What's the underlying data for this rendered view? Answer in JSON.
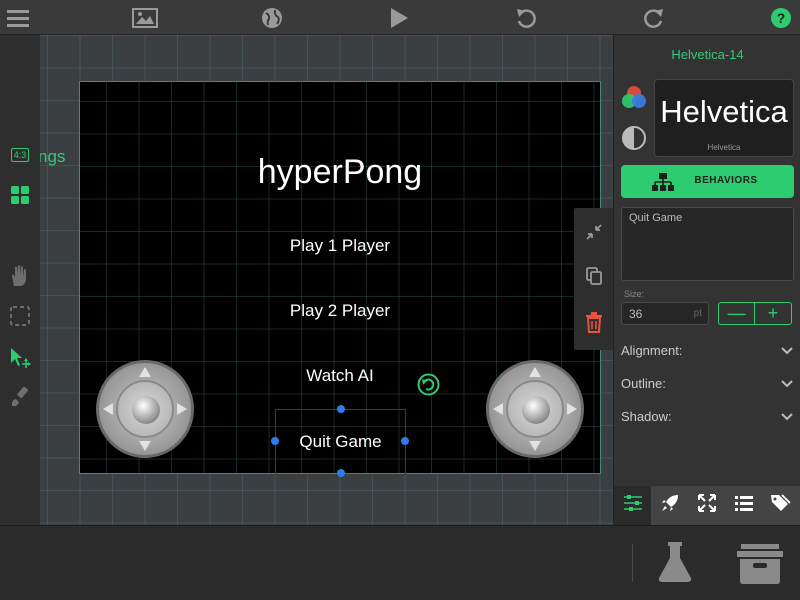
{
  "toolbar": {
    "icons": [
      "menu-icon",
      "image-icon",
      "globe-icon",
      "play-icon",
      "undo-icon",
      "redo-icon",
      "help-icon"
    ]
  },
  "left_tools": {
    "aspect_label": "4:3",
    "icons": [
      "aspect-ratio-icon",
      "grid-icon",
      "hand-icon",
      "marquee-select-icon",
      "pointer-move-icon",
      "brush-icon"
    ]
  },
  "canvas": {
    "partial_label": "ngs",
    "title": "hyperPong",
    "menu": [
      "Play 1 Player",
      "Play 2 Player",
      "Watch AI",
      "Quit Game"
    ]
  },
  "inspector": {
    "font_name": "Helvetica-14",
    "font_preview_large": "Helvetica",
    "font_preview_small": "Helvetica",
    "behaviors_label": "BEHAVIORS",
    "text_value": "Quit Game",
    "size_label": "Size:",
    "size_value": "36",
    "size_unit": "pt",
    "minus_label": "—",
    "plus_label": "+",
    "properties": [
      "Alignment:",
      "Outline:",
      "Shadow:"
    ]
  },
  "colors": {
    "accent": "#2ecc71",
    "selection": "#2f7dea",
    "delete": "#e8533f"
  }
}
